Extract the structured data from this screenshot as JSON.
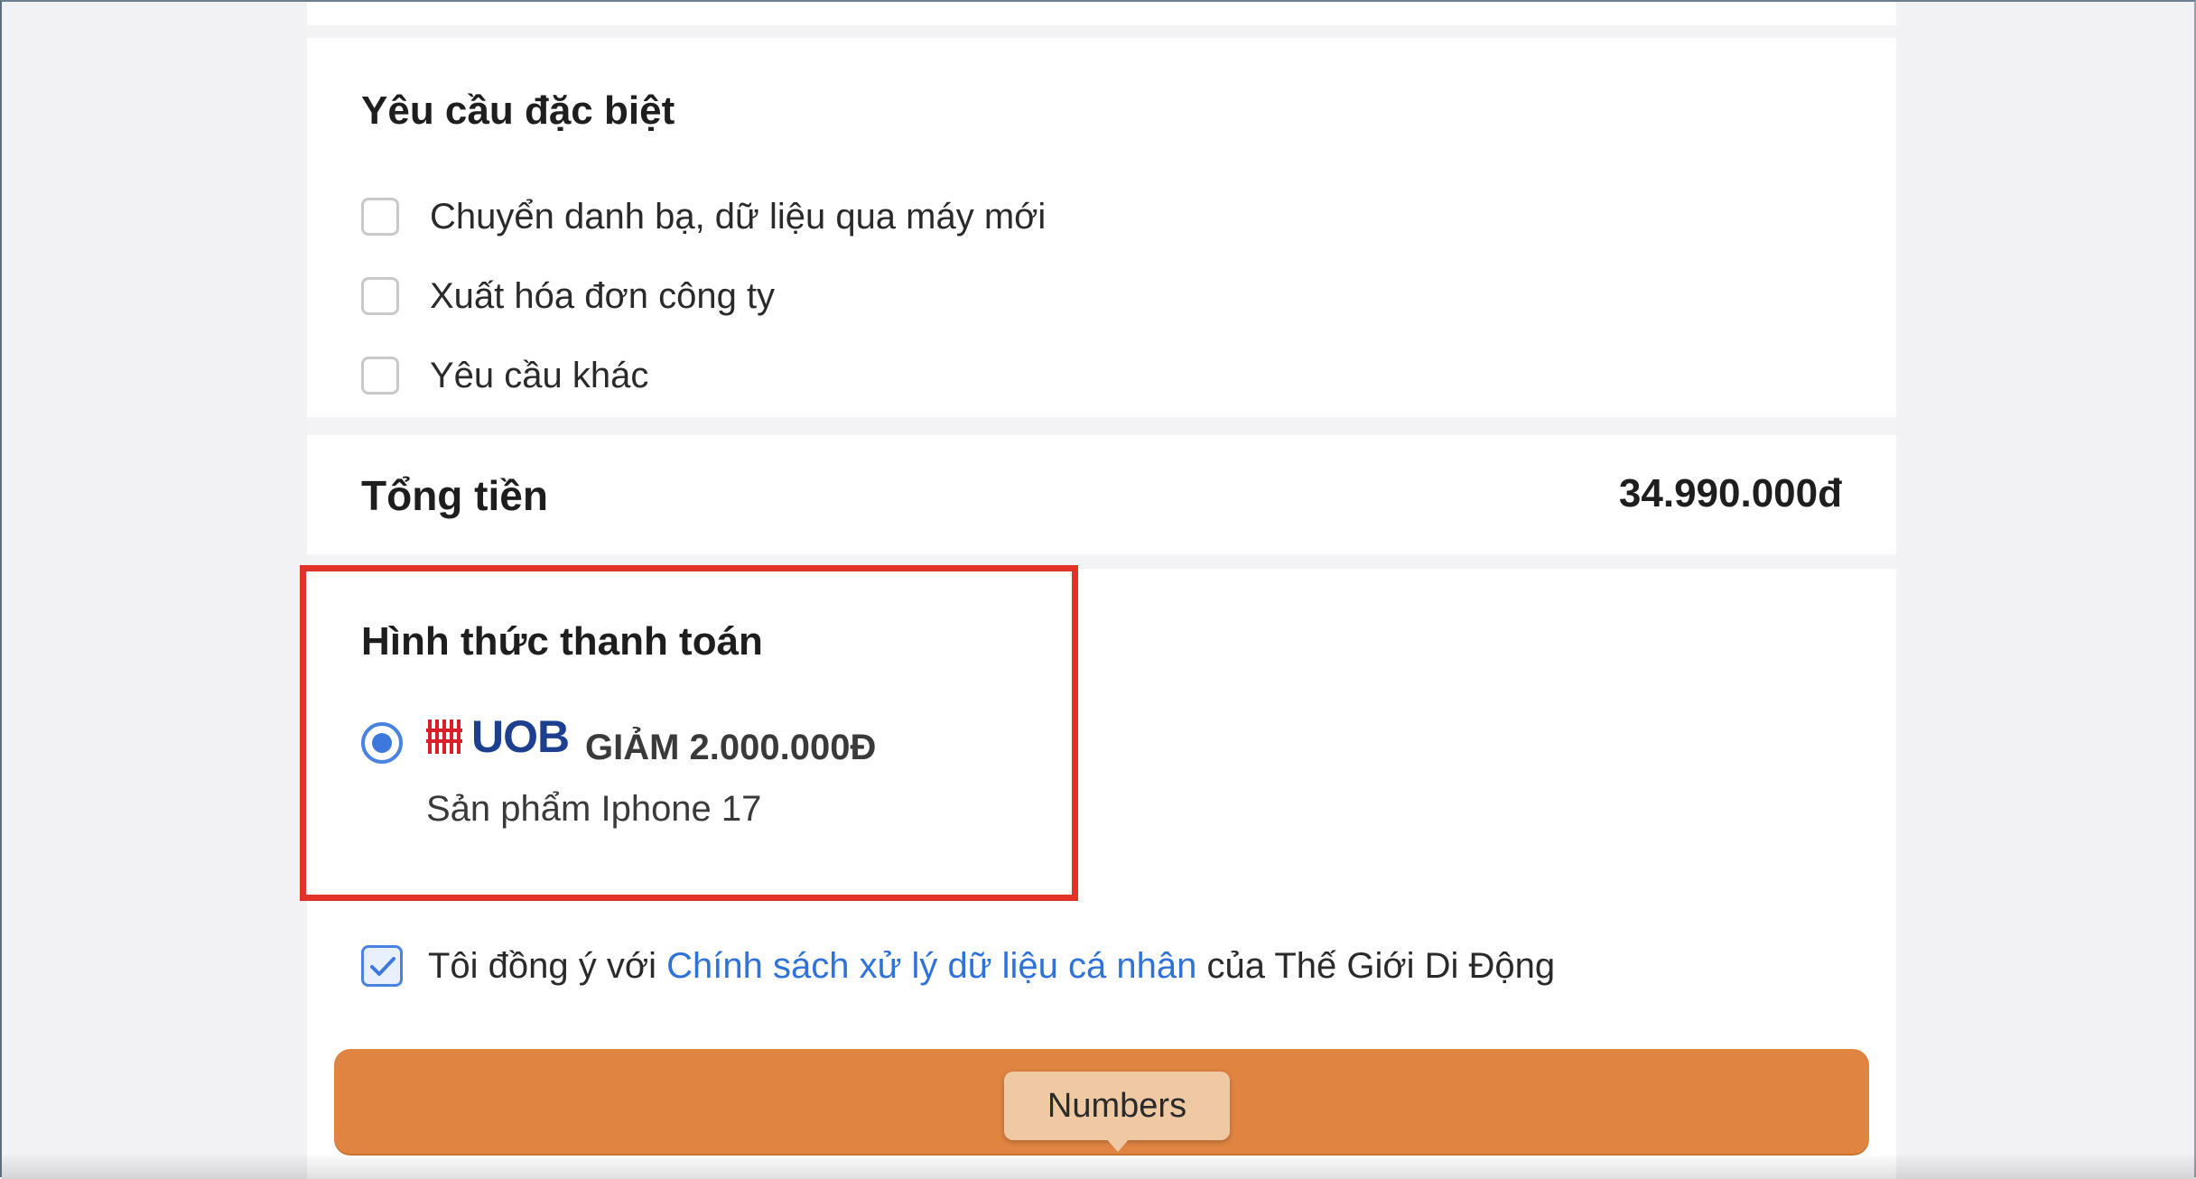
{
  "special_requests": {
    "title": "Yêu cầu đặc biệt",
    "options": [
      {
        "label": "Chuyển danh bạ, dữ liệu qua máy mới",
        "checked": false
      },
      {
        "label": "Xuất hóa đơn công ty",
        "checked": false
      },
      {
        "label": "Yêu cầu khác",
        "checked": false
      }
    ]
  },
  "total": {
    "label": "Tổng tiền",
    "value": "34.990.000đ"
  },
  "payment": {
    "title": "Hình thức thanh toán",
    "method": {
      "bank": "UOB",
      "discount": "GIẢM 2.000.000Đ",
      "note": "Sản phẩm Iphone 17",
      "selected": true
    }
  },
  "agreement": {
    "checked": true,
    "prefix": "Tôi đồng ý với ",
    "link": "Chính sách xử lý dữ liệu cá nhân",
    "suffix": " của Thế Giới Di Động"
  },
  "tooltip": {
    "label": "Numbers"
  },
  "colors": {
    "accent_button": "#e08442",
    "link": "#2f73d9",
    "highlight": "#e23127",
    "uob_red": "#d9202a",
    "uob_blue": "#1d3f8f"
  }
}
